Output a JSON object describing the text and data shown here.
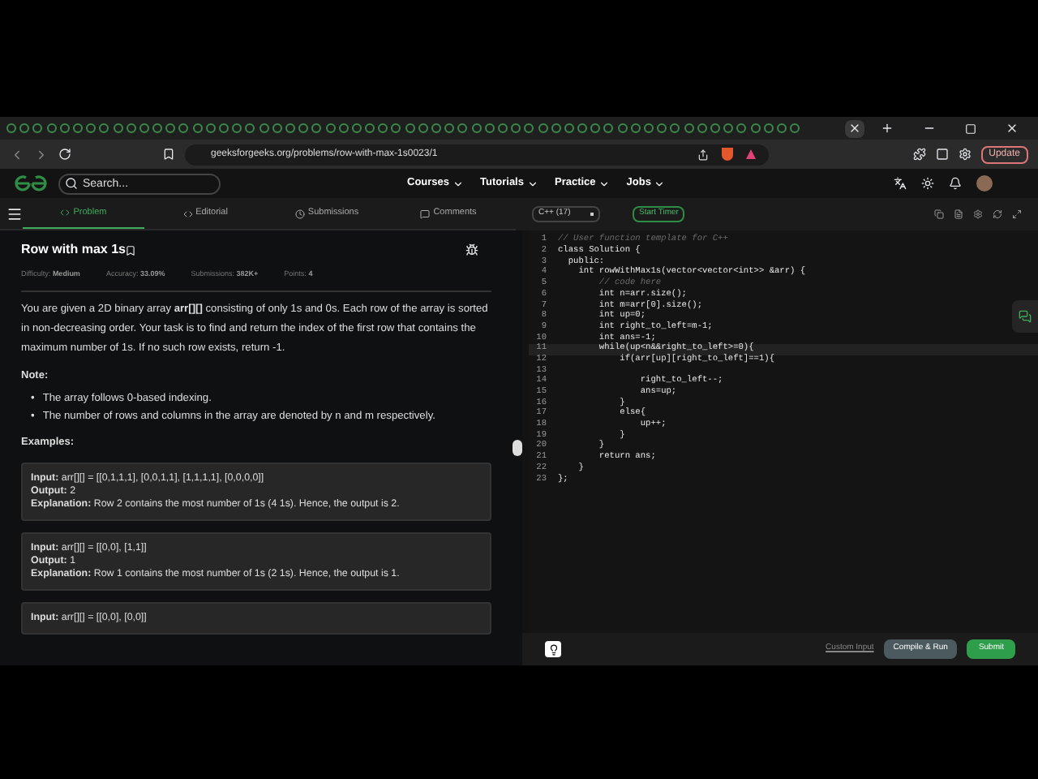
{
  "browser": {
    "url": "geeksforgeeks.org/problems/row-with-max-1s0023/1",
    "update_button": "Update"
  },
  "site_nav": {
    "search_placeholder": "Search...",
    "menu": [
      {
        "label": "Courses"
      },
      {
        "label": "Tutorials"
      },
      {
        "label": "Practice"
      },
      {
        "label": "Jobs"
      }
    ]
  },
  "problem_tabs": [
    {
      "label": "Problem",
      "selected": true
    },
    {
      "label": "Editorial",
      "selected": false
    },
    {
      "label": "Submissions",
      "selected": false
    },
    {
      "label": "Comments",
      "selected": false
    }
  ],
  "editor_toolbar": {
    "language": "C++ (17)",
    "timer_button": "Start Timer"
  },
  "problem": {
    "title": "Row with max 1s",
    "meta": [
      {
        "label": "Difficulty:",
        "value": "Medium"
      },
      {
        "label": "Accuracy:",
        "value": "33.09%"
      },
      {
        "label": "Submissions:",
        "value": "382K+"
      },
      {
        "label": "Points:",
        "value": "4"
      }
    ],
    "description": "You are given a 2D binary array **arr[][]** consisting of only 1s and 0s. Each row of the array is sorted in non-decreasing order. Your task is to find and return the index of the first row that contains the maximum number of 1s. If no such row exists, return -1.",
    "note_heading": "Note:",
    "notes": [
      {
        "marker": "•",
        "text": "The array follows 0-based indexing."
      },
      {
        "marker": "•",
        "text": "The number of rows and columns in the array are denoted by n and m respectively."
      }
    ],
    "examples_heading": "Examples:",
    "examples": [
      {
        "lines": [
          {
            "label": "Input:",
            "value": "arr[][] = [[0,1,1,1], [0,0,1,1], [1,1,1,1], [0,0,0,0]]"
          },
          {
            "label": "Output:",
            "value": "2"
          },
          {
            "label": "Explanation:",
            "value": "Row 2 contains the most number of 1s (4 1s). Hence, the output is 2."
          }
        ]
      },
      {
        "lines": [
          {
            "label": "Input:",
            "value": "arr[][] = [[0,0], [1,1]]"
          },
          {
            "label": "Output:",
            "value": "1"
          },
          {
            "label": "Explanation:",
            "value": "Row 1 contains the most number of 1s (2 1s). Hence, the output is 1."
          }
        ]
      },
      {
        "lines": [
          {
            "label": "Input:",
            "value": "arr[][] = [[0,0], [0,0]]"
          }
        ]
      }
    ]
  },
  "code": [
    {
      "n": "1",
      "text": "// User function template for C++",
      "kind": "comment",
      "selected": false
    },
    {
      "n": "2",
      "text": "class Solution {",
      "kind": "code",
      "selected": false
    },
    {
      "n": "3",
      "text": "  public:",
      "kind": "code",
      "selected": false
    },
    {
      "n": "4",
      "text": "    int rowWithMax1s(vector<vector<int>> &arr) {",
      "kind": "code",
      "selected": false
    },
    {
      "n": "5",
      "text": "        // code here",
      "kind": "comment",
      "selected": false
    },
    {
      "n": "6",
      "text": "        int n=arr.size();",
      "kind": "code",
      "selected": false
    },
    {
      "n": "7",
      "text": "        int m=arr[0].size();",
      "kind": "code",
      "selected": false
    },
    {
      "n": "8",
      "text": "        int up=0;",
      "kind": "code",
      "selected": false
    },
    {
      "n": "9",
      "text": "        int right_to_left=m-1;",
      "kind": "code",
      "selected": false
    },
    {
      "n": "10",
      "text": "        int ans=-1;",
      "kind": "code",
      "selected": false
    },
    {
      "n": "11",
      "text": "        while(up<n&&right_to_left>=0){",
      "kind": "code",
      "selected": true
    },
    {
      "n": "12",
      "text": "            if(arr[up][right_to_left]==1){",
      "kind": "code",
      "selected": false
    },
    {
      "n": "13",
      "selected": false
    },
    {
      "n": "14",
      "text": "                right_to_left--;",
      "kind": "code",
      "selected": false
    },
    {
      "n": "15",
      "text": "                ans=up;",
      "kind": "code",
      "selected": false
    },
    {
      "n": "16",
      "text": "            }",
      "kind": "code",
      "selected": false
    },
    {
      "n": "17",
      "text": "            else{",
      "kind": "code",
      "selected": false
    },
    {
      "n": "18",
      "text": "                up++;",
      "kind": "code",
      "selected": false
    },
    {
      "n": "19",
      "text": "            }",
      "kind": "code",
      "selected": false
    },
    {
      "n": "20",
      "text": "        }",
      "kind": "code",
      "selected": false
    },
    {
      "n": "21",
      "text": "        return ans;",
      "kind": "code",
      "selected": false
    },
    {
      "n": "22",
      "text": "    }",
      "kind": "code",
      "selected": false
    },
    {
      "n": "23",
      "text": "};",
      "kind": "code",
      "selected": false
    }
  ],
  "footer": {
    "custom_input": "Custom Input",
    "compile_button": "Compile & Run",
    "submit_button": "Submit"
  }
}
